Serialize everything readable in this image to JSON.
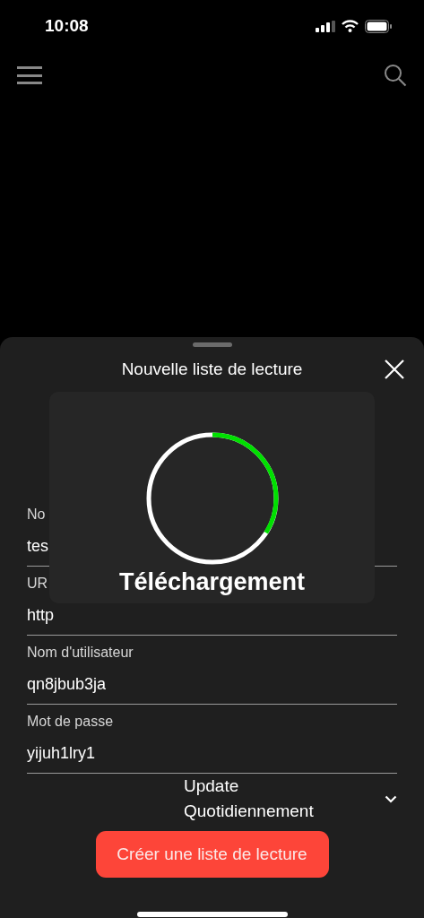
{
  "status_bar": {
    "time": "10:08"
  },
  "sheet": {
    "title": "Nouvelle liste de lecture",
    "fields": [
      {
        "label": "No",
        "value": "tes"
      },
      {
        "label": "UR",
        "value": "http"
      },
      {
        "label": "Nom d'utilisateur",
        "value": "qn8jbub3ja"
      },
      {
        "label": "Mot de passe",
        "value": "yijuh1lry1"
      }
    ],
    "update_picker": {
      "label": "Update",
      "value": "Quotidiennement"
    },
    "create_button": "Créer une liste de lecture"
  },
  "progress_hud": {
    "level": 0.34,
    "label": "Téléchargement"
  }
}
